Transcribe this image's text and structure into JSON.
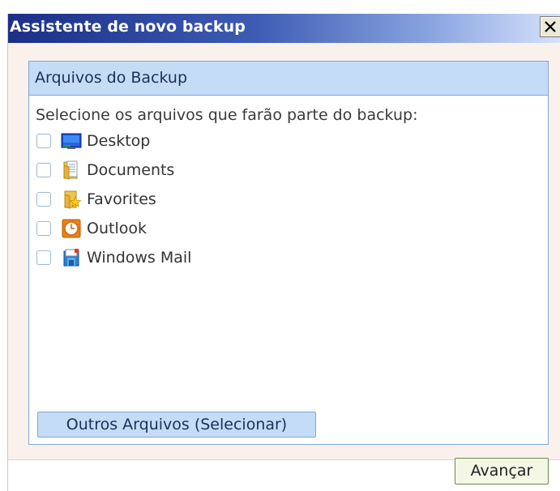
{
  "window": {
    "title": "Assistente de novo backup",
    "close_symbol": "✕"
  },
  "panel": {
    "title": "Arquivos do Backup",
    "instruction": "Selecione os arquivos que farão parte do backup:",
    "items": [
      {
        "label": "Desktop",
        "icon": "desktop-icon",
        "checked": false
      },
      {
        "label": "Documents",
        "icon": "documents-folder-icon",
        "checked": false
      },
      {
        "label": "Favorites",
        "icon": "favorites-folder-icon",
        "checked": false
      },
      {
        "label": "Outlook",
        "icon": "outlook-icon",
        "checked": false
      },
      {
        "label": "Windows Mail",
        "icon": "windows-mail-icon",
        "checked": false
      }
    ],
    "other_files_label": "Outros Arquivos (Selecionar)"
  },
  "footer": {
    "next_label": "Avançar"
  },
  "colors": {
    "titlebar_start": "#1b2f87",
    "titlebar_end": "#d6e2fb",
    "panel_header": "#c5dcf6",
    "panel_border": "#7fa6d6",
    "dialog_background": "#fbf1ec"
  }
}
